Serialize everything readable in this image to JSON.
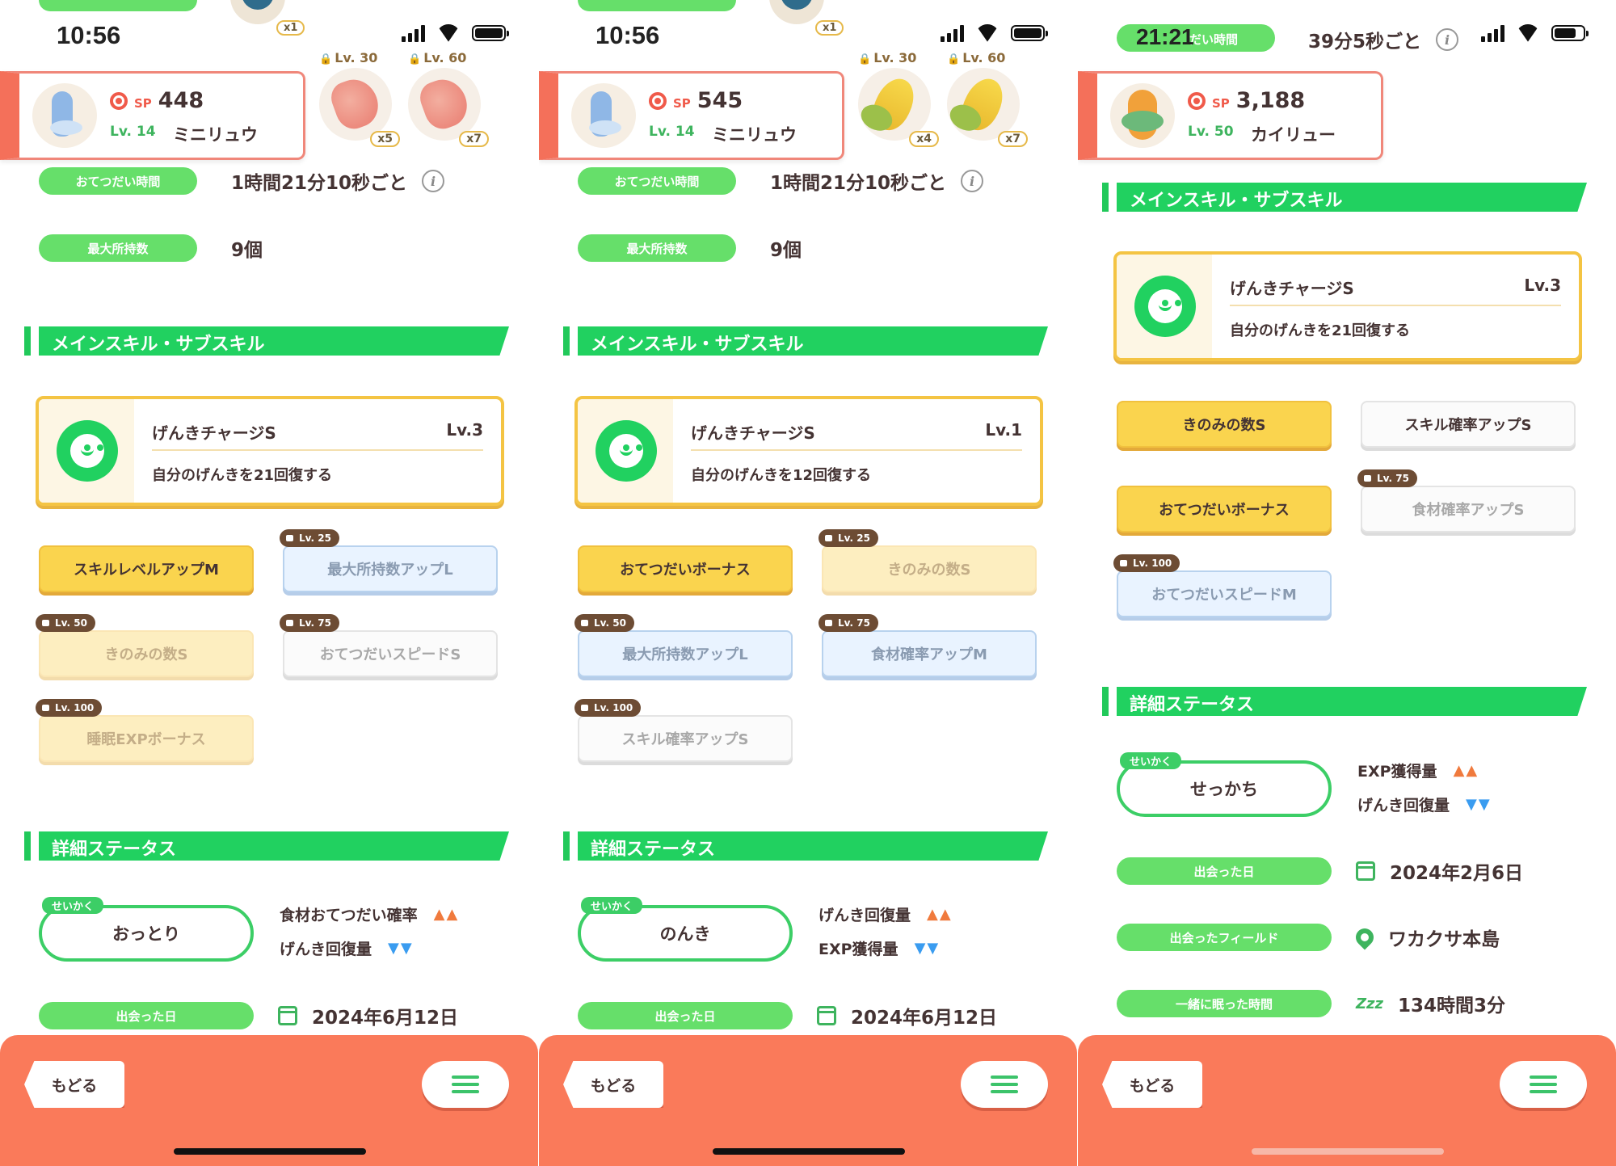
{
  "screens": [
    {
      "status": {
        "time": "10:56"
      },
      "top_items": [
        {
          "lv": "",
          "qty": "x1"
        },
        {
          "lv": "Lv. 30",
          "qty": "x5"
        },
        {
          "lv": "Lv. 60",
          "qty": "x7"
        }
      ],
      "pokemon": {
        "sp_label": "SP",
        "sp": "448",
        "level": "Lv. 14",
        "name": "ミニリュウ"
      },
      "help_time": {
        "label": "おてつだい時間",
        "value": "1時間21分10秒ごと"
      },
      "max_carry": {
        "label": "最大所持数",
        "value": "9個"
      },
      "skills_title": "メインスキル・サブスキル",
      "main_skill": {
        "name": "げんきチャージS",
        "lv": "Lv.3",
        "desc": "自分のげんきを21回復する"
      },
      "subskills": [
        {
          "label": "スキルレベルアップM",
          "style": "gold",
          "lock": ""
        },
        {
          "label": "最大所持数アップL",
          "style": "blue",
          "lock": "Lv. 25"
        },
        {
          "label": "きのみの数S",
          "style": "gold-locked",
          "lock": "Lv. 50"
        },
        {
          "label": "おてつだいスピードS",
          "style": "white",
          "lock": "Lv. 75"
        },
        {
          "label": "睡眠EXPボーナス",
          "style": "gold-locked",
          "lock": "Lv. 100"
        }
      ],
      "detail_title": "詳細ステータス",
      "nature": {
        "tag": "せいかく",
        "name": "おっとり",
        "up": "食材おてつだい確率",
        "up_marks": "▲▲",
        "down": "げんき回復量",
        "down_marks": "▼▼"
      },
      "met_date": {
        "label": "出会った日",
        "value": "2024年6月12日"
      },
      "bottom": {
        "back": "もどる"
      }
    },
    {
      "status": {
        "time": "10:56"
      },
      "top_items": [
        {
          "lv": "",
          "qty": "x1"
        },
        {
          "lv": "Lv. 30",
          "qty": "x4"
        },
        {
          "lv": "Lv. 60",
          "qty": "x7"
        }
      ],
      "pokemon": {
        "sp_label": "SP",
        "sp": "545",
        "level": "Lv. 14",
        "name": "ミニリュウ"
      },
      "help_time": {
        "label": "おてつだい時間",
        "value": "1時間21分10秒ごと"
      },
      "max_carry": {
        "label": "最大所持数",
        "value": "9個"
      },
      "skills_title": "メインスキル・サブスキル",
      "main_skill": {
        "name": "げんきチャージS",
        "lv": "Lv.1",
        "desc": "自分のげんきを12回復する"
      },
      "subskills": [
        {
          "label": "おてつだいボーナス",
          "style": "gold",
          "lock": ""
        },
        {
          "label": "きのみの数S",
          "style": "gold-locked",
          "lock": "Lv. 25"
        },
        {
          "label": "最大所持数アップL",
          "style": "blue",
          "lock": "Lv. 50"
        },
        {
          "label": "食材確率アップM",
          "style": "blue",
          "lock": "Lv. 75"
        },
        {
          "label": "スキル確率アップS",
          "style": "white",
          "lock": "Lv. 100"
        }
      ],
      "detail_title": "詳細ステータス",
      "nature": {
        "tag": "せいかく",
        "name": "のんき",
        "up": "げんき回復量",
        "up_marks": "▲▲",
        "down": "EXP獲得量",
        "down_marks": "▼▼"
      },
      "met_date": {
        "label": "出会った日",
        "value": "2024年6月12日"
      },
      "bottom": {
        "back": "もどる"
      }
    },
    {
      "status": {
        "time": "21:21",
        "pill_label": "だい時間",
        "help_value": "39分5秒ごと"
      },
      "pokemon": {
        "sp_label": "SP",
        "sp": "3,188",
        "level": "Lv. 50",
        "name": "カイリュー"
      },
      "skills_title": "メインスキル・サブスキル",
      "main_skill": {
        "name": "げんきチャージS",
        "lv": "Lv.3",
        "desc": "自分のげんきを21回復する"
      },
      "subskills": [
        {
          "label": "きのみの数S",
          "style": "gold",
          "lock": ""
        },
        {
          "label": "スキル確率アップS",
          "style": "white",
          "lock": ""
        },
        {
          "label": "おてつだいボーナス",
          "style": "gold",
          "lock": ""
        },
        {
          "label": "食材確率アップS",
          "style": "white",
          "lock": "Lv. 75"
        },
        {
          "label": "おてつだいスピードM",
          "style": "blue",
          "lock": "Lv. 100"
        }
      ],
      "detail_title": "詳細ステータス",
      "nature": {
        "tag": "せいかく",
        "name": "せっかち",
        "up": "EXP獲得量",
        "up_marks": "▲▲",
        "down": "げんき回復量",
        "down_marks": "▼▼"
      },
      "met_date": {
        "label": "出会った日",
        "value": "2024年2月6日"
      },
      "met_field": {
        "label": "出会ったフィールド",
        "value": "ワカクサ本島"
      },
      "slept_time": {
        "label": "一緒に眠った時間",
        "icon_text": "Zzz",
        "value": "134時間3分"
      },
      "bottom": {
        "back": "もどる"
      }
    }
  ]
}
